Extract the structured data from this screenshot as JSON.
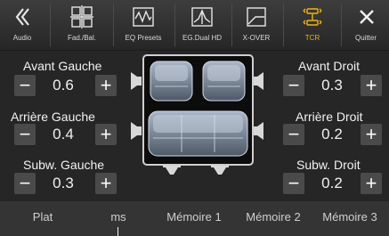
{
  "toolbar": {
    "items": [
      {
        "icon": "back-icon",
        "label": "Audio"
      },
      {
        "icon": "fader-balance-icon",
        "label": "Fad./Bal."
      },
      {
        "icon": "eq-presets-icon",
        "label": "EQ Presets"
      },
      {
        "icon": "eq-dual-hd-icon",
        "label": "EG.Dual HD"
      },
      {
        "icon": "crossover-icon",
        "label": "X-OVER"
      },
      {
        "icon": "tcr-icon",
        "label": "TCR",
        "active": true
      },
      {
        "icon": "close-icon",
        "label": "Quitter"
      }
    ],
    "accent_color": "#f6b500"
  },
  "panels": {
    "avant_gauche": {
      "title": "Avant Gauche",
      "value": "0.6"
    },
    "arriere_gauche": {
      "title": "Arrière Gauche",
      "value": "0.4"
    },
    "subw_gauche": {
      "title": "Subw. Gauche",
      "value": "0.3"
    },
    "avant_droit": {
      "title": "Avant Droit",
      "value": "0.3"
    },
    "arriere_droit": {
      "title": "Arrière Droit",
      "value": "0.2"
    },
    "subw_droit": {
      "title": "Subw. Droit",
      "value": "0.2"
    }
  },
  "buttons": {
    "minus": "−",
    "plus": "+"
  },
  "bottom_bar": {
    "items": [
      "Plat",
      "ms",
      "Mémoire 1",
      "Mémoire 2",
      "Mémoire 3"
    ]
  }
}
